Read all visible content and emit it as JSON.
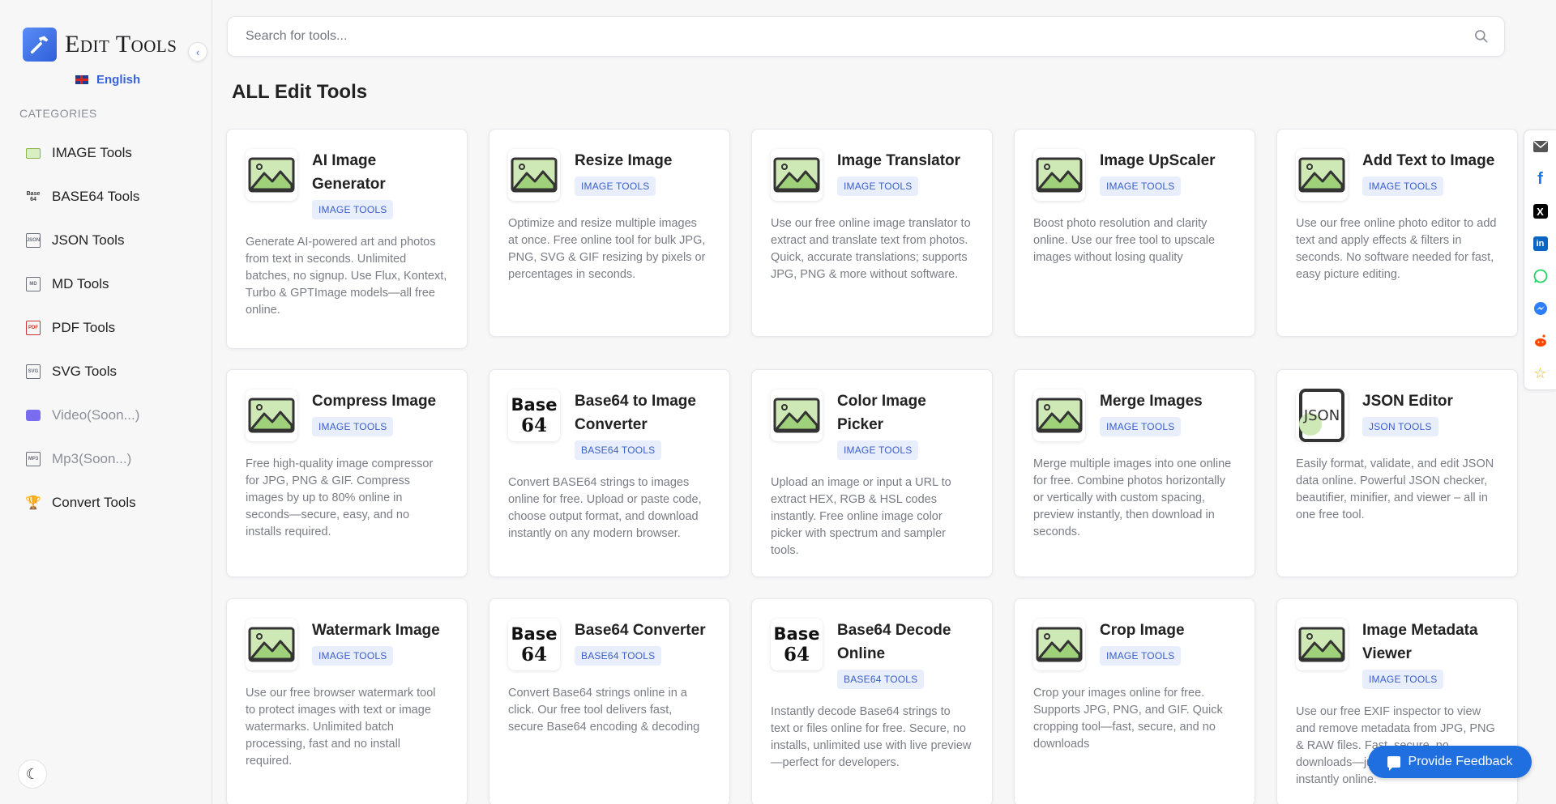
{
  "brand": {
    "name": "Edit Tools",
    "language": "English"
  },
  "sidebar": {
    "section_title": "CATEGORIES",
    "items": [
      {
        "label": "IMAGE Tools",
        "icon": "image-icon",
        "soon": false
      },
      {
        "label": "BASE64 Tools",
        "icon": "base64-icon",
        "soon": false
      },
      {
        "label": "JSON Tools",
        "icon": "json-icon",
        "soon": false
      },
      {
        "label": "MD Tools",
        "icon": "markdown-icon",
        "soon": false
      },
      {
        "label": "PDF Tools",
        "icon": "pdf-icon",
        "soon": false
      },
      {
        "label": "SVG Tools",
        "icon": "svg-icon",
        "soon": false
      },
      {
        "label": "Video(Soon...)",
        "icon": "video-icon",
        "soon": true
      },
      {
        "label": "Mp3(Soon...)",
        "icon": "mp3-icon",
        "soon": true
      },
      {
        "label": "Convert Tools",
        "icon": "trophy-icon",
        "soon": false
      }
    ]
  },
  "search": {
    "placeholder": "Search for tools..."
  },
  "main": {
    "title": "ALL Edit Tools"
  },
  "tools": [
    {
      "title": "AI Image Generator",
      "badge": "IMAGE TOOLS",
      "thumb": "image",
      "desc": "Generate AI-powered art and photos from text in seconds. Unlimited batches, no signup. Use Flux, Kontext, Turbo & GPTImage models—all free online."
    },
    {
      "title": "Resize Image",
      "badge": "IMAGE TOOLS",
      "thumb": "image",
      "desc": "Optimize and resize multiple images at once. Free online tool for bulk JPG, PNG, SVG & GIF resizing by pixels or percentages in seconds."
    },
    {
      "title": "Image Translator",
      "badge": "IMAGE TOOLS",
      "thumb": "image",
      "desc": "Use our free online image translator to extract and translate text from photos. Quick, accurate translations; supports JPG, PNG & more without software."
    },
    {
      "title": "Image UpScaler",
      "badge": "IMAGE TOOLS",
      "thumb": "image",
      "desc": "Boost photo resolution and clarity online. Use our free tool to upscale images without losing quality"
    },
    {
      "title": "Add Text to Image",
      "badge": "IMAGE TOOLS",
      "thumb": "image",
      "desc": "Use our free online photo editor to add text and apply effects & filters in seconds. No software needed for fast, easy picture editing."
    },
    {
      "title": "Compress Image",
      "badge": "IMAGE TOOLS",
      "thumb": "image",
      "desc": "Free high-quality image compressor for JPG, PNG & GIF. Compress images by up to 80% online in seconds—secure, easy, and no installs required."
    },
    {
      "title": "Base64 to Image Converter",
      "badge": "BASE64 TOOLS",
      "thumb": "base64",
      "desc": "Convert BASE64 strings to images online for free. Upload or paste code, choose output format, and download instantly on any modern browser."
    },
    {
      "title": "Color Image Picker",
      "badge": "IMAGE TOOLS",
      "thumb": "image",
      "desc": "Upload an image or input a URL to extract HEX, RGB & HSL codes instantly. Free online image color picker with spectrum and sampler tools."
    },
    {
      "title": "Merge Images",
      "badge": "IMAGE TOOLS",
      "thumb": "image",
      "desc": "Merge multiple images into one online for free. Combine photos horizontally or vertically with custom spacing, preview instantly, then download in seconds."
    },
    {
      "title": "JSON Editor",
      "badge": "JSON TOOLS",
      "thumb": "json",
      "desc": "Easily format, validate, and edit JSON data online. Powerful JSON checker, beautifier, minifier, and viewer – all in one free tool."
    },
    {
      "title": "Watermark Image",
      "badge": "IMAGE TOOLS",
      "thumb": "image",
      "desc": "Use our free browser watermark tool to protect images with text or image watermarks. Unlimited batch processing, fast and no install required."
    },
    {
      "title": "Base64 Converter",
      "badge": "BASE64 TOOLS",
      "thumb": "base64",
      "desc": "Convert Base64 strings online in a click. Our free tool delivers fast, secure Base64 encoding & decoding"
    },
    {
      "title": "Base64 Decode Online",
      "badge": "BASE64 TOOLS",
      "thumb": "base64",
      "desc": "Instantly decode Base64 strings to text or files online for free. Secure, no installs, unlimited use with live preview—perfect for developers."
    },
    {
      "title": "Crop Image",
      "badge": "IMAGE TOOLS",
      "thumb": "image",
      "desc": "Crop your images online for free. Supports JPG, PNG, and GIF. Quick cropping tool—fast, secure, and no downloads"
    },
    {
      "title": "Image Metadata Viewer",
      "badge": "IMAGE TOOLS",
      "thumb": "image",
      "desc": "Use our free EXIF inspector to view and remove metadata from JPG, PNG & RAW files. Fast, secure, no downloads—just upload and view instantly online."
    }
  ],
  "thumb_text": {
    "base64_top": "Base",
    "base64_bottom": "64",
    "json": "JSON"
  },
  "share": [
    "email-icon",
    "facebook-icon",
    "x-icon",
    "linkedin-icon",
    "whatsapp-icon",
    "messenger-icon",
    "reddit-icon",
    "star-icon"
  ],
  "feedback": {
    "label": "Provide Feedback"
  },
  "colors": {
    "accent": "#3a63d8",
    "badge_bg": "#e8eefc",
    "badge_text": "#3a5fc8",
    "feedback_bg": "#1f6fe0"
  }
}
